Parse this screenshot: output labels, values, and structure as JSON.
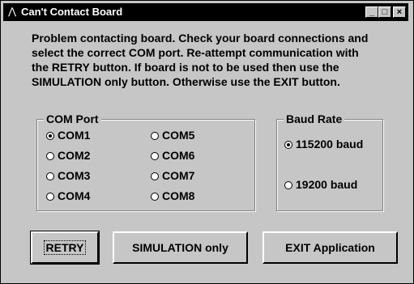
{
  "window": {
    "title": "Can't Contact Board",
    "icon": "app-icon",
    "minimize_glyph": "_",
    "maximize_glyph": "□",
    "close_glyph": "×"
  },
  "message": "Problem contacting board.  Check your board connections and\nselect the correct COM port.  Re-attempt communication with\nthe RETRY button.  If board is not to be used then use the\nSIMULATION only button.  Otherwise use the EXIT button.",
  "com_port": {
    "label": "COM Port",
    "options": [
      "COM1",
      "COM2",
      "COM3",
      "COM4",
      "COM5",
      "COM6",
      "COM7",
      "COM8"
    ],
    "selected": "COM1"
  },
  "baud_rate": {
    "label": "Baud Rate",
    "options": [
      "115200 baud",
      "19200 baud"
    ],
    "selected": "115200 baud"
  },
  "buttons": {
    "retry": "RETRY",
    "simulation": "SIMULATION only",
    "exit": "EXIT Application"
  }
}
